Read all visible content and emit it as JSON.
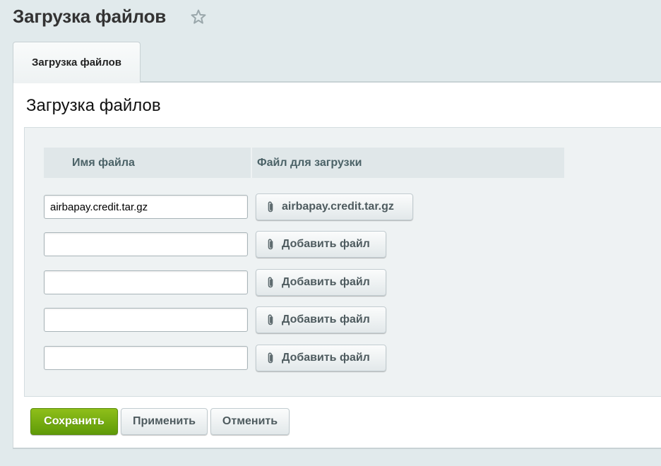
{
  "page": {
    "title": "Загрузка файлов"
  },
  "tabs": [
    {
      "label": "Загрузка файлов",
      "active": true
    }
  ],
  "section": {
    "title": "Загрузка файлов"
  },
  "table": {
    "headers": {
      "name": "Имя файла",
      "file": "Файл для загрузки"
    },
    "rows": [
      {
        "name_value": "airbapay.credit.tar.gz",
        "file_label": "airbapay.credit.tar.gz"
      },
      {
        "name_value": "",
        "file_label": "Добавить файл"
      },
      {
        "name_value": "",
        "file_label": "Добавить файл"
      },
      {
        "name_value": "",
        "file_label": "Добавить файл"
      },
      {
        "name_value": "",
        "file_label": "Добавить файл"
      }
    ]
  },
  "actions": {
    "save": "Сохранить",
    "apply": "Применить",
    "cancel": "Отменить"
  },
  "icons": {
    "favorite": "star-icon",
    "attach": "paperclip-icon"
  },
  "colors": {
    "save_button": "#6aa50f",
    "background": "#e1eaec",
    "header_cell": "#e0e7e9"
  }
}
